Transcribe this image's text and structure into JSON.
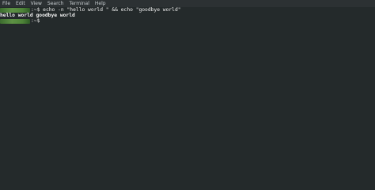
{
  "menubar": {
    "items": [
      "File",
      "Edit",
      "View",
      "Search",
      "Terminal",
      "Help"
    ]
  },
  "terminal": {
    "prompt_suffix": ":~$",
    "command": " echo -n \"hello world \" && echo \"goodbye world\"",
    "output": "hello world goodbye world",
    "second_prompt_suffix": ":~$"
  }
}
